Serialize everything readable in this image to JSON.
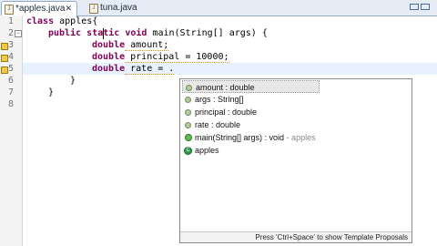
{
  "tabs": [
    {
      "label": "*apples.java",
      "active": true
    },
    {
      "label": "tuna.java",
      "active": false
    }
  ],
  "line_numbers": [
    "1",
    "2",
    "3",
    "4",
    "5",
    "6",
    "7",
    "8"
  ],
  "code": {
    "line1": {
      "kw": "class",
      "rest": " apples{"
    },
    "line2": {
      "kw1": "public",
      "kw2": "static",
      "kw3": "void",
      "rest": " main(String[] args) {"
    },
    "line3": {
      "kw": "double",
      "rest": " amount;"
    },
    "line4": {
      "kw": "double",
      "rest": " principal = 10000;"
    },
    "line5": {
      "kw": "double",
      "rest": " rate = ."
    },
    "line6": "}",
    "line7": "}"
  },
  "autocomplete": {
    "proposals": [
      {
        "label": "amount : double",
        "icon": "local-variable-icon"
      },
      {
        "label": "args : String[]",
        "icon": "local-variable-icon"
      },
      {
        "label": "principal : double",
        "icon": "local-variable-icon"
      },
      {
        "label": "rate : double",
        "icon": "local-variable-icon"
      },
      {
        "label": "main(String[] args) : void",
        "qualifier": "- apples",
        "icon": "public-method-icon"
      },
      {
        "label": "apples",
        "icon": "class-icon"
      }
    ],
    "status": "Press 'Ctrl+Space' to show Template Proposals"
  },
  "colors": {
    "keyword": "#7f0055",
    "current_line": "#e8f2fe",
    "tab_bar": "#e5ecf5"
  }
}
